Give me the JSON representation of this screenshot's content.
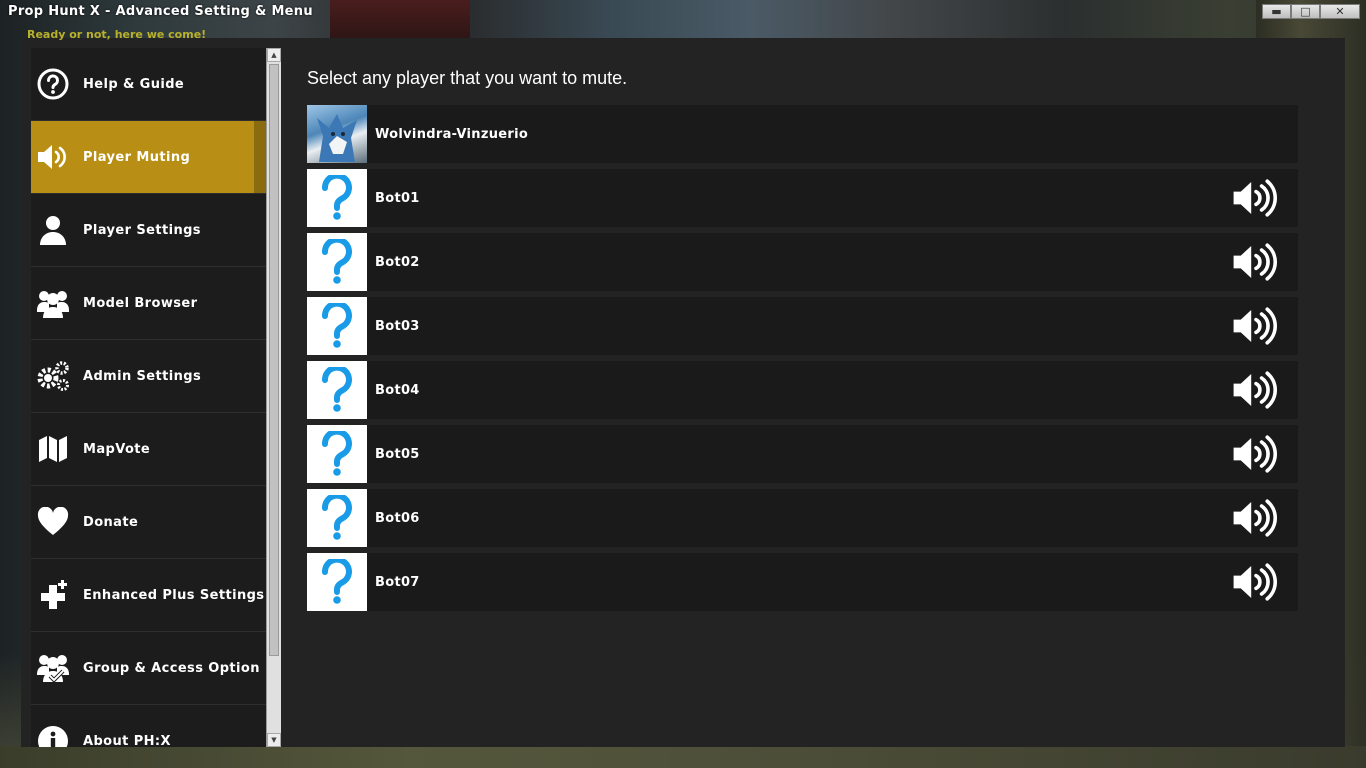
{
  "window": {
    "title": "Prop Hunt X - Advanced Setting & Menu",
    "subtitle": "Ready or not, here we come!",
    "controls": {
      "minimize": "▬",
      "maximize": "□",
      "close": "✕"
    }
  },
  "sidebar": {
    "items": [
      {
        "label": "Help & Guide",
        "icon": "help-icon",
        "active": false
      },
      {
        "label": "Player Muting",
        "icon": "speaker-icon",
        "active": true
      },
      {
        "label": "Player Settings",
        "icon": "user-icon",
        "active": false
      },
      {
        "label": "Model Browser",
        "icon": "users-icon",
        "active": false
      },
      {
        "label": "Admin Settings",
        "icon": "gears-icon",
        "active": false
      },
      {
        "label": "MapVote",
        "icon": "map-icon",
        "active": false
      },
      {
        "label": "Donate",
        "icon": "heart-icon",
        "active": false
      },
      {
        "label": "Enhanced Plus Settings",
        "icon": "plus-icon",
        "active": false
      },
      {
        "label": "Group & Access Option",
        "icon": "group-access-icon",
        "active": false
      },
      {
        "label": "About PH:X",
        "icon": "info-icon",
        "active": false
      }
    ]
  },
  "main": {
    "heading": "Select any player that you want to mute.",
    "players": [
      {
        "name": "Wolvindra-Vinzuerio",
        "avatar": "custom-avatar",
        "muteable": false
      },
      {
        "name": "Bot01",
        "avatar": "unknown-avatar",
        "muteable": true
      },
      {
        "name": "Bot02",
        "avatar": "unknown-avatar",
        "muteable": true
      },
      {
        "name": "Bot03",
        "avatar": "unknown-avatar",
        "muteable": true
      },
      {
        "name": "Bot04",
        "avatar": "unknown-avatar",
        "muteable": true
      },
      {
        "name": "Bot05",
        "avatar": "unknown-avatar",
        "muteable": true
      },
      {
        "name": "Bot06",
        "avatar": "unknown-avatar",
        "muteable": true
      },
      {
        "name": "Bot07",
        "avatar": "unknown-avatar",
        "muteable": true
      }
    ]
  },
  "colors": {
    "accent": "#b88f14",
    "panel": "#232323",
    "row": "#1a1a1a",
    "question_mark": "#1a9be8",
    "subtitle": "#b9b12a"
  }
}
